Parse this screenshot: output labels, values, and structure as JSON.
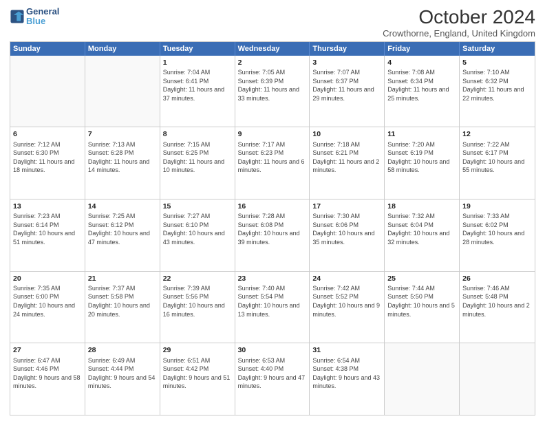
{
  "header": {
    "logo_line1": "General",
    "logo_line2": "Blue",
    "month_title": "October 2024",
    "subtitle": "Crowthorne, England, United Kingdom"
  },
  "days_of_week": [
    "Sunday",
    "Monday",
    "Tuesday",
    "Wednesday",
    "Thursday",
    "Friday",
    "Saturday"
  ],
  "weeks": [
    [
      {
        "day": "",
        "text": ""
      },
      {
        "day": "",
        "text": ""
      },
      {
        "day": "1",
        "text": "Sunrise: 7:04 AM\nSunset: 6:41 PM\nDaylight: 11 hours and 37 minutes."
      },
      {
        "day": "2",
        "text": "Sunrise: 7:05 AM\nSunset: 6:39 PM\nDaylight: 11 hours and 33 minutes."
      },
      {
        "day": "3",
        "text": "Sunrise: 7:07 AM\nSunset: 6:37 PM\nDaylight: 11 hours and 29 minutes."
      },
      {
        "day": "4",
        "text": "Sunrise: 7:08 AM\nSunset: 6:34 PM\nDaylight: 11 hours and 25 minutes."
      },
      {
        "day": "5",
        "text": "Sunrise: 7:10 AM\nSunset: 6:32 PM\nDaylight: 11 hours and 22 minutes."
      }
    ],
    [
      {
        "day": "6",
        "text": "Sunrise: 7:12 AM\nSunset: 6:30 PM\nDaylight: 11 hours and 18 minutes."
      },
      {
        "day": "7",
        "text": "Sunrise: 7:13 AM\nSunset: 6:28 PM\nDaylight: 11 hours and 14 minutes."
      },
      {
        "day": "8",
        "text": "Sunrise: 7:15 AM\nSunset: 6:25 PM\nDaylight: 11 hours and 10 minutes."
      },
      {
        "day": "9",
        "text": "Sunrise: 7:17 AM\nSunset: 6:23 PM\nDaylight: 11 hours and 6 minutes."
      },
      {
        "day": "10",
        "text": "Sunrise: 7:18 AM\nSunset: 6:21 PM\nDaylight: 11 hours and 2 minutes."
      },
      {
        "day": "11",
        "text": "Sunrise: 7:20 AM\nSunset: 6:19 PM\nDaylight: 10 hours and 58 minutes."
      },
      {
        "day": "12",
        "text": "Sunrise: 7:22 AM\nSunset: 6:17 PM\nDaylight: 10 hours and 55 minutes."
      }
    ],
    [
      {
        "day": "13",
        "text": "Sunrise: 7:23 AM\nSunset: 6:14 PM\nDaylight: 10 hours and 51 minutes."
      },
      {
        "day": "14",
        "text": "Sunrise: 7:25 AM\nSunset: 6:12 PM\nDaylight: 10 hours and 47 minutes."
      },
      {
        "day": "15",
        "text": "Sunrise: 7:27 AM\nSunset: 6:10 PM\nDaylight: 10 hours and 43 minutes."
      },
      {
        "day": "16",
        "text": "Sunrise: 7:28 AM\nSunset: 6:08 PM\nDaylight: 10 hours and 39 minutes."
      },
      {
        "day": "17",
        "text": "Sunrise: 7:30 AM\nSunset: 6:06 PM\nDaylight: 10 hours and 35 minutes."
      },
      {
        "day": "18",
        "text": "Sunrise: 7:32 AM\nSunset: 6:04 PM\nDaylight: 10 hours and 32 minutes."
      },
      {
        "day": "19",
        "text": "Sunrise: 7:33 AM\nSunset: 6:02 PM\nDaylight: 10 hours and 28 minutes."
      }
    ],
    [
      {
        "day": "20",
        "text": "Sunrise: 7:35 AM\nSunset: 6:00 PM\nDaylight: 10 hours and 24 minutes."
      },
      {
        "day": "21",
        "text": "Sunrise: 7:37 AM\nSunset: 5:58 PM\nDaylight: 10 hours and 20 minutes."
      },
      {
        "day": "22",
        "text": "Sunrise: 7:39 AM\nSunset: 5:56 PM\nDaylight: 10 hours and 16 minutes."
      },
      {
        "day": "23",
        "text": "Sunrise: 7:40 AM\nSunset: 5:54 PM\nDaylight: 10 hours and 13 minutes."
      },
      {
        "day": "24",
        "text": "Sunrise: 7:42 AM\nSunset: 5:52 PM\nDaylight: 10 hours and 9 minutes."
      },
      {
        "day": "25",
        "text": "Sunrise: 7:44 AM\nSunset: 5:50 PM\nDaylight: 10 hours and 5 minutes."
      },
      {
        "day": "26",
        "text": "Sunrise: 7:46 AM\nSunset: 5:48 PM\nDaylight: 10 hours and 2 minutes."
      }
    ],
    [
      {
        "day": "27",
        "text": "Sunrise: 6:47 AM\nSunset: 4:46 PM\nDaylight: 9 hours and 58 minutes."
      },
      {
        "day": "28",
        "text": "Sunrise: 6:49 AM\nSunset: 4:44 PM\nDaylight: 9 hours and 54 minutes."
      },
      {
        "day": "29",
        "text": "Sunrise: 6:51 AM\nSunset: 4:42 PM\nDaylight: 9 hours and 51 minutes."
      },
      {
        "day": "30",
        "text": "Sunrise: 6:53 AM\nSunset: 4:40 PM\nDaylight: 9 hours and 47 minutes."
      },
      {
        "day": "31",
        "text": "Sunrise: 6:54 AM\nSunset: 4:38 PM\nDaylight: 9 hours and 43 minutes."
      },
      {
        "day": "",
        "text": ""
      },
      {
        "day": "",
        "text": ""
      }
    ]
  ]
}
